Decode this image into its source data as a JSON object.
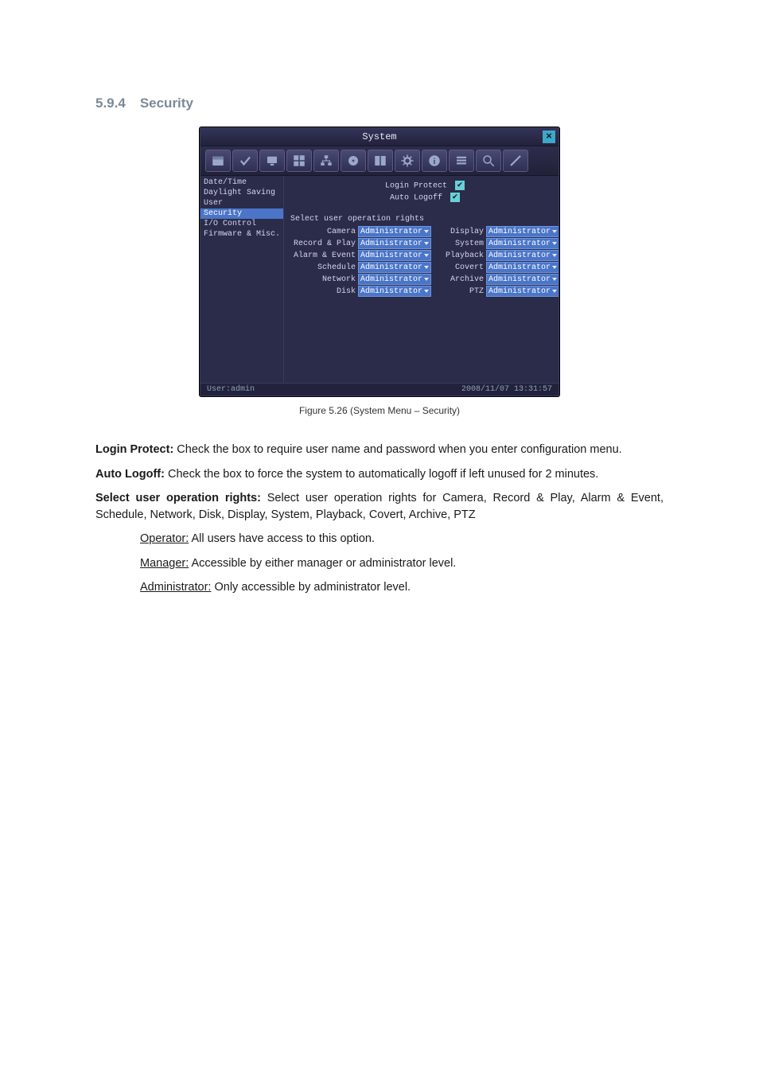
{
  "heading": {
    "num": "5.9.4",
    "title": "Security"
  },
  "window": {
    "title": "System",
    "close_glyph": "×",
    "sidebar": {
      "items": [
        {
          "label": "Date/Time"
        },
        {
          "label": "Daylight Saving"
        },
        {
          "label": "User"
        },
        {
          "label": "Security"
        },
        {
          "label": "I/O Control"
        },
        {
          "label": "Firmware & Misc."
        }
      ],
      "selected_index": 3
    },
    "options": {
      "login_protect_label": "Login Protect",
      "login_protect_checked": "✔",
      "auto_logoff_label": "Auto Logoff",
      "auto_logoff_checked": "✔"
    },
    "rights_title": "Select user operation rights",
    "rights_value": "Administrator",
    "rights_left": [
      {
        "label": "Camera"
      },
      {
        "label": "Record & Play"
      },
      {
        "label": "Alarm & Event"
      },
      {
        "label": "Schedule"
      },
      {
        "label": "Network"
      },
      {
        "label": "Disk"
      }
    ],
    "rights_right": [
      {
        "label": "Display"
      },
      {
        "label": "System"
      },
      {
        "label": "Playback"
      },
      {
        "label": "Covert"
      },
      {
        "label": "Archive"
      },
      {
        "label": "PTZ"
      }
    ],
    "status": {
      "user": "User:admin",
      "datetime": "2008/11/07  13:31:57"
    }
  },
  "caption": "Figure 5.26 (System Menu – Security)",
  "text": {
    "login_protect_label": "Login Protect:",
    "login_protect_desc": " Check the box to require user name and password when you enter configuration menu.",
    "auto_logoff_label": "Auto Logoff:",
    "auto_logoff_desc": " Check the box to force the system to automatically logoff if left unused for 2 minutes.",
    "select_rights_label": "Select user operation rights:",
    "select_rights_desc": " Select user operation rights for Camera, Record & Play, Alarm & Event, Schedule, Network, Disk, Display, System, Playback, Covert, Archive, PTZ",
    "defs": {
      "operator_label": "Operator:",
      "operator_desc": " All users have access to this option.",
      "manager_label": "Manager:",
      "manager_desc": " Accessible by either manager or administrator level.",
      "admin_label": "Administrator:",
      "admin_desc": " Only accessible by administrator level."
    }
  }
}
